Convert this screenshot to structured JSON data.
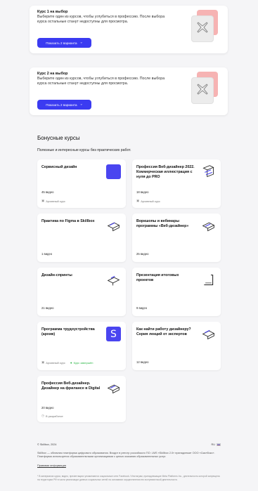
{
  "electives": [
    {
      "title": "Курс 1 на выбор",
      "description": "Выберите один из курсов, чтобы углубиться в профессию. После выбора курса остальные станут недоступны для просмотра.",
      "button_label": "Показать 2 варианта"
    },
    {
      "title": "Курс 2 на выбор",
      "description": "Выберите один из курсов, чтобы углубиться в профессию. После выбора курса остальные станут недоступны для просмотра.",
      "button_label": "Показать 2 варианта"
    }
  ],
  "bonus": {
    "title": "Бонусные курсы",
    "subtitle": "Полезные и интересные курсы без практических работ."
  },
  "courses": [
    {
      "title": "Сервисный дизайн",
      "count": "45 видео",
      "tag": "Архивный курс",
      "thumb": "square-icon"
    },
    {
      "title": "Профессия Веб-дизайнер 2022. Коммерческая иллюстрация с нуля до PRO",
      "count": "18 видео",
      "tag": "Архивный курс",
      "thumb": "isometric-icon"
    },
    {
      "title": "Практика по Figma в Skillbox",
      "count": "1 видео",
      "thumb": "isometric-icon"
    },
    {
      "title": "Воркшопы и вебинары программы «Веб-дизайнер»",
      "count": "25 видео",
      "thumb": "isometric-icon"
    },
    {
      "title": "Дизайн-спринты",
      "count": "21 видео",
      "thumb": "isometric-icon"
    },
    {
      "title": "Презентация итоговых проектов",
      "count": "9 видео",
      "thumb": "isometric-icon"
    },
    {
      "title": "Программа трудоустройства (архив)",
      "tag": "Архивный курс",
      "tag2": "Курс завершён",
      "thumb": "s-logo-icon",
      "thumb_letter": "S"
    },
    {
      "title": "Как найти работу дизайнеру? Серия лекций от экспертов",
      "count": "12 видео",
      "thumb": "isometric-icon"
    },
    {
      "title": "Профессия Веб-дизайнер. Дизайнер на фрилансе в Digital",
      "count": "20 видео",
      "tag": "В разработке",
      "thumb": "isometric-icon"
    }
  ],
  "footer": {
    "copyright": "© Skillbox, 2024",
    "language": "RU",
    "legal": "Skillbox — облачная платформа цифрового образования. Входит в реестр российского ПО: LMS «Skillbox 2.0» принадлежит ООО «Скилбокс». Платформа используется образовательными организациями с целью оказания образовательных услуг.",
    "policy_link": "Правовая информация",
    "note": "* В материалах курса, видео, презентациях упоминаются социальные сети Facebook / Инстаграм, принадлежащие Meta Platforms Inc., деятельность которой запрещена на территории РФ в части реализации данных социальных сетей на основании осуществления ею экстремистской деятельности."
  },
  "colors": {
    "accent": "#3b3bf1",
    "success": "#2fb84a",
    "background": "#f5f5f7"
  }
}
